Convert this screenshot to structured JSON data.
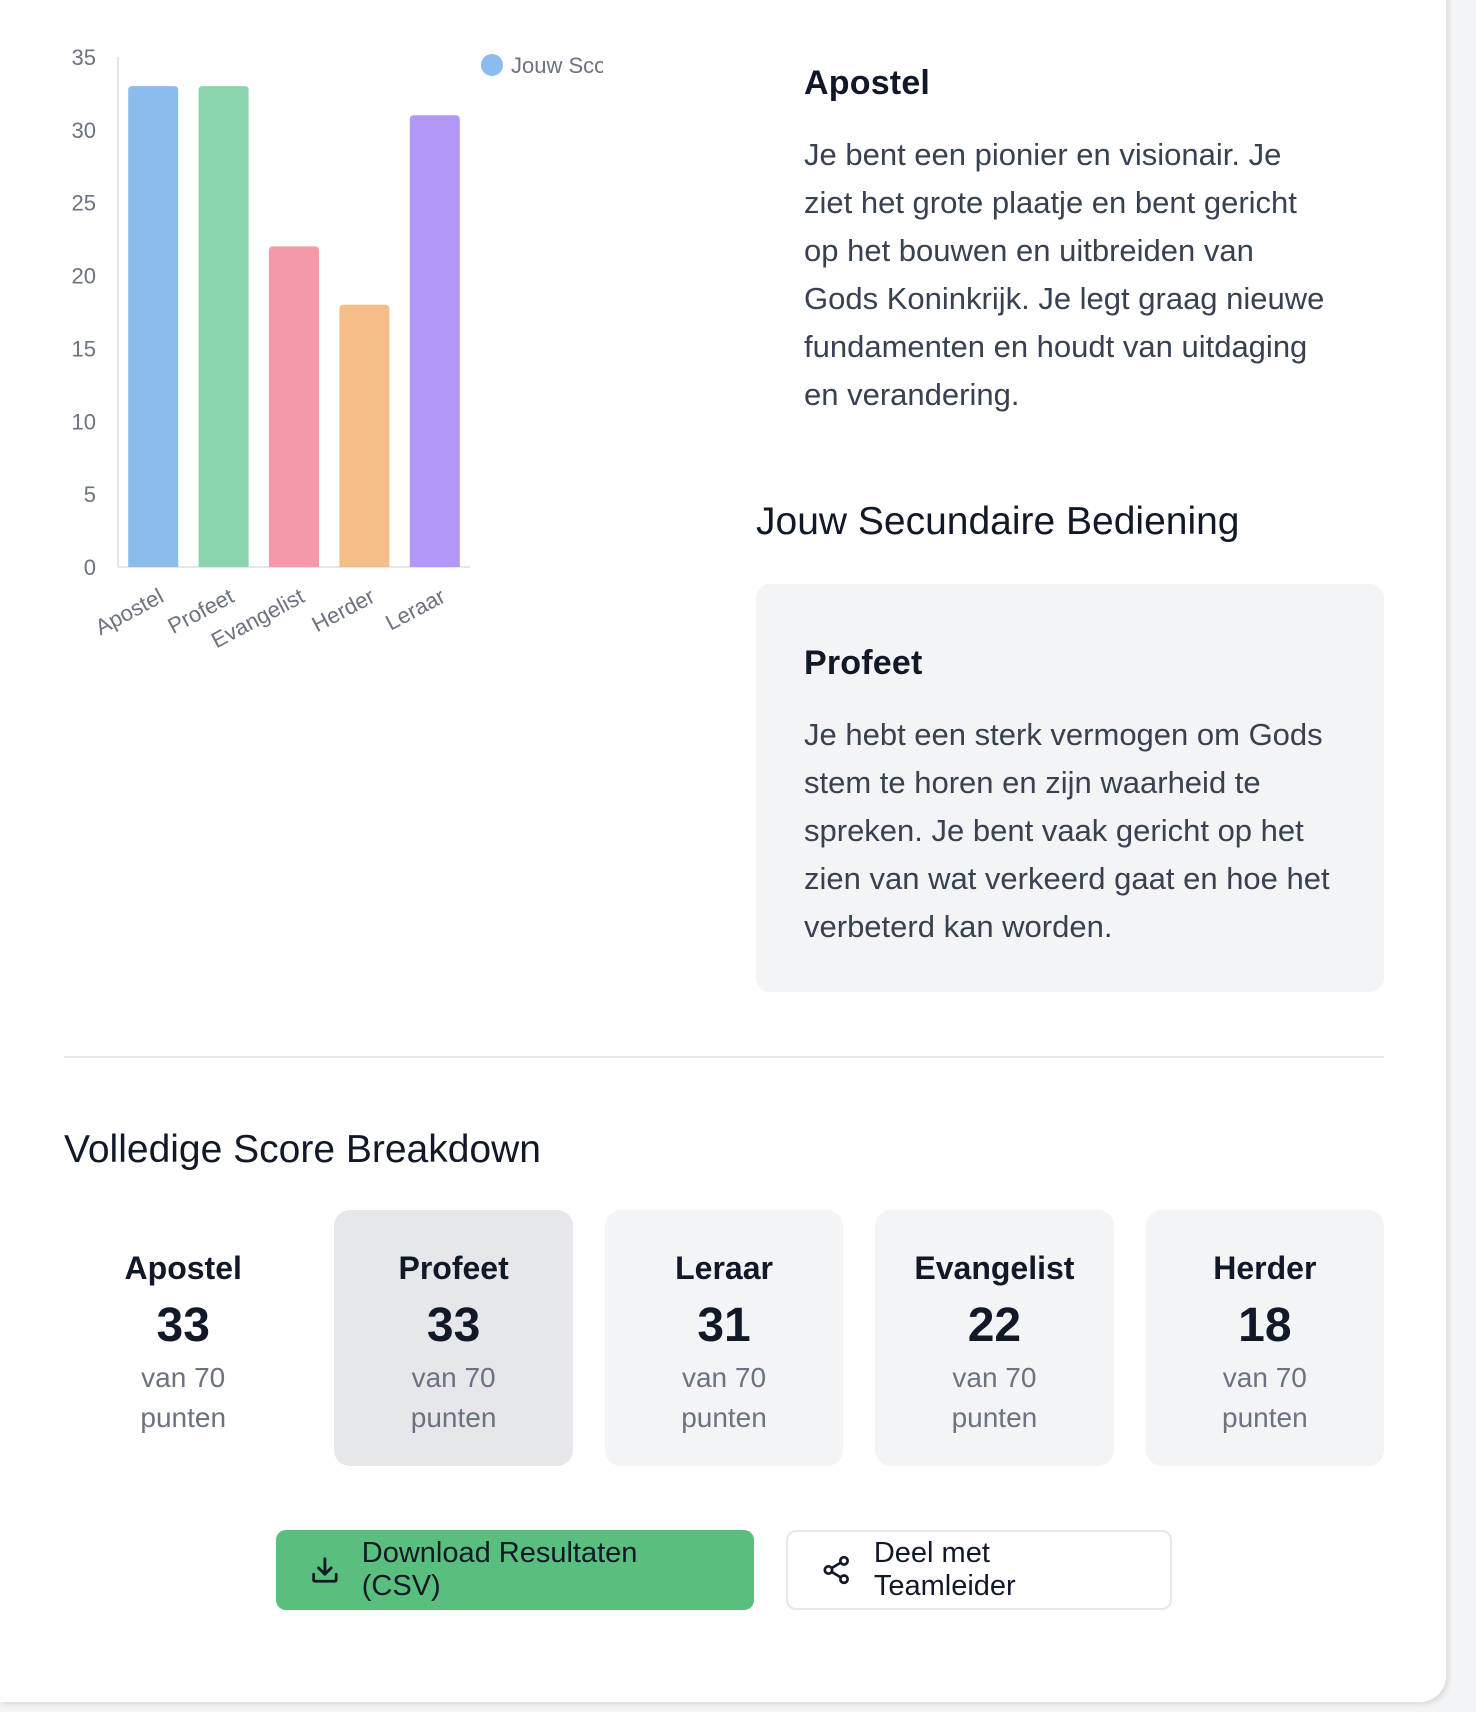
{
  "chart_data": {
    "type": "bar",
    "categories": [
      "Apostel",
      "Profeet",
      "Evangelist",
      "Herder",
      "Leraar"
    ],
    "series": [
      {
        "name": "Jouw Sco",
        "values": [
          33,
          33,
          22,
          18,
          31
        ]
      }
    ],
    "colors": [
      "#8bbcee",
      "#8ad4ad",
      "#f399a8",
      "#f5be88",
      "#b297f7"
    ],
    "yticks": [
      0,
      5,
      10,
      15,
      20,
      25,
      30,
      35
    ],
    "ylim": [
      0,
      35
    ],
    "legend": "top-right",
    "legend_color": "#8bbcee",
    "grid": false
  },
  "primary": {
    "title": "Apostel",
    "text": "Je bent een pionier en visionair. Je ziet het grote plaatje en bent gericht op het bouwen en uitbreiden van Gods Koninkrijk. Je legt graag nieuwe fundamenten en houdt van uitdaging en verandering."
  },
  "secondary": {
    "heading": "Jouw Secundaire Bediening",
    "title": "Profeet",
    "text": "Je hebt een sterk vermogen om Gods stem te horen en zijn waarheid te spreken. Je bent vaak gericht op het zien van wat verkeerd gaat en hoe het verbeterd kan worden."
  },
  "breakdown": {
    "title": "Volledige Score Breakdown",
    "cards": [
      {
        "name": "Apostel",
        "score": "33",
        "unit": "van 70 punten"
      },
      {
        "name": "Profeet",
        "score": "33",
        "unit": "van 70 punten"
      },
      {
        "name": "Leraar",
        "score": "31",
        "unit": "van 70 punten"
      },
      {
        "name": "Evangelist",
        "score": "22",
        "unit": "van 70 punten"
      },
      {
        "name": "Herder",
        "score": "18",
        "unit": "van 70 punten"
      }
    ]
  },
  "actions": {
    "download_label": "Download Resultaten (CSV)",
    "download_icon": "download-icon",
    "share_label": "Deel met Teamleider",
    "share_icon": "share-icon"
  }
}
